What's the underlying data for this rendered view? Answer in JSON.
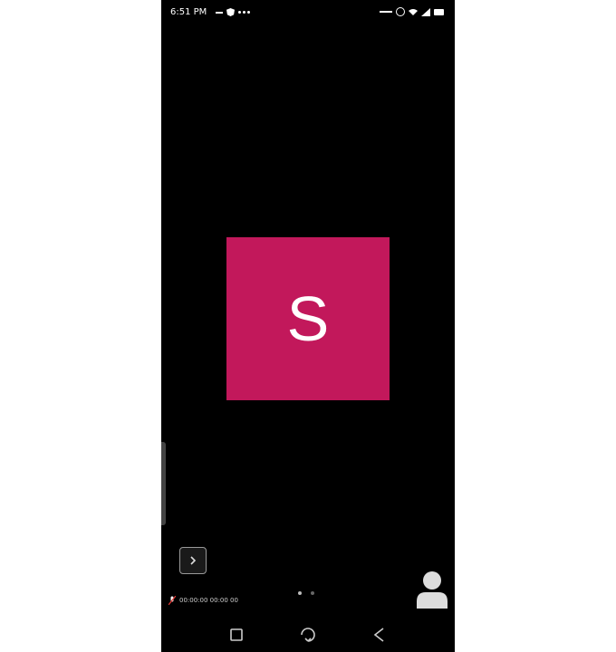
{
  "status_bar": {
    "time": "6:51 PM",
    "icons_left": [
      "message-icon",
      "shield-icon",
      "more-dots-icon"
    ],
    "icons_right": [
      "network-speed-icon",
      "alarm-icon",
      "wifi-icon",
      "signal-icon",
      "battery-icon"
    ]
  },
  "participant": {
    "initial": "S",
    "tile_color": "#c2185b"
  },
  "meeting": {
    "info_text": "00:00:00 00:00 00"
  },
  "colors": {
    "background": "#000000",
    "accent": "#c2185b"
  }
}
